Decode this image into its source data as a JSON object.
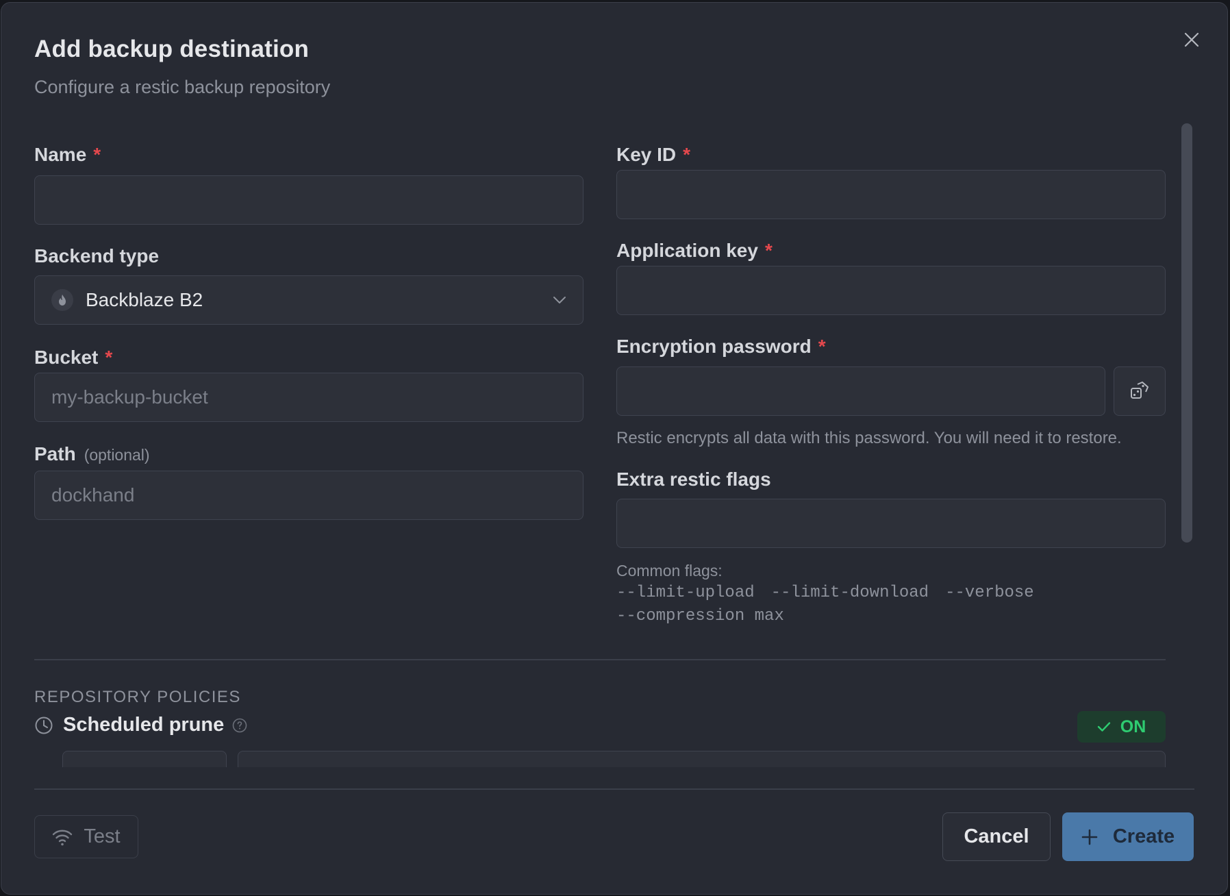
{
  "dialog": {
    "title": "Add backup destination",
    "subtitle": "Configure a restic backup repository",
    "close_icon": "close-icon"
  },
  "left": {
    "name": {
      "label": "Name",
      "required": "*",
      "value": "",
      "placeholder": ""
    },
    "backend_type": {
      "label": "Backend type",
      "selected": "Backblaze B2",
      "icon": "backblaze-flame-icon"
    },
    "bucket": {
      "label": "Bucket",
      "required": "*",
      "value": "",
      "placeholder": "my-backup-bucket"
    },
    "path": {
      "label": "Path",
      "optional": "(optional)",
      "value": "",
      "placeholder": "dockhand"
    }
  },
  "right": {
    "key_id": {
      "label": "Key ID",
      "required": "*",
      "value": ""
    },
    "application_key": {
      "label": "Application key",
      "required": "*",
      "value": ""
    },
    "encryption_password": {
      "label": "Encryption password",
      "required": "*",
      "value": "",
      "hint": "Restic encrypts all data with this password. You will need it to restore.",
      "generate_icon": "dice-icon"
    },
    "extra_flags": {
      "label": "Extra restic flags",
      "value": "",
      "common_label": "Common flags:",
      "flags": [
        "--limit-upload",
        "--limit-download",
        "--verbose",
        "--compression max"
      ]
    }
  },
  "policies": {
    "section_title": "REPOSITORY POLICIES",
    "scheduled_prune": {
      "label": "Scheduled prune",
      "status": "ON"
    }
  },
  "footer": {
    "test_label": "Test",
    "cancel_label": "Cancel",
    "create_label": "Create"
  },
  "colors": {
    "background": "#272a33",
    "required": "#e5484d",
    "on_badge_bg": "#1d3d2d",
    "on_badge_text": "#2ecc71",
    "primary": "#4a79a9"
  }
}
